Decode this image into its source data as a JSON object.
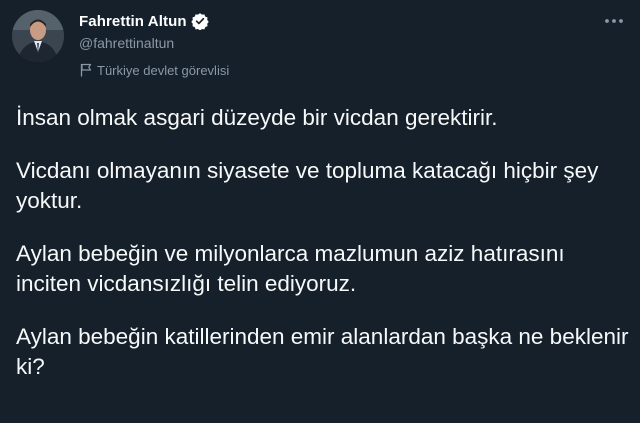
{
  "author": {
    "display_name": "Fahrettin Altun",
    "handle": "@fahrettinaltun",
    "verified": true,
    "label_icon": "flag-icon",
    "label": "Türkiye devlet görevlisi"
  },
  "menu": {
    "icon": "more-icon"
  },
  "tweet": {
    "paragraphs": [
      "İnsan olmak asgari düzeyde bir vicdan gerektirir.",
      "Vicdanı olmayanın siyasete ve topluma katacağı hiçbir şey yoktur.",
      "Aylan bebeğin ve milyonlarca mazlumun aziz hatırasını inciten vicdansızlığı telin ediyoruz.",
      "Aylan bebeğin katillerinden emir alanlardan başka ne beklenir ki?"
    ]
  },
  "colors": {
    "background": "#15202b",
    "text": "#f7f9f9",
    "secondary_text": "#8b98a5",
    "verified_badge": "#ffffff"
  }
}
